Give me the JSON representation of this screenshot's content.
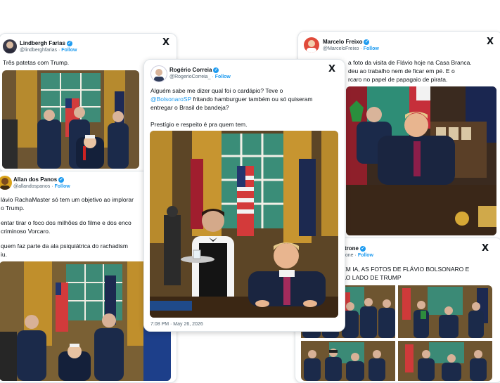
{
  "cards": {
    "lindbergh": {
      "name": "Lindbergh Farias",
      "handle": "@lindberghfarias",
      "follow": "Follow",
      "text": "Três patetas com Trump."
    },
    "allan": {
      "name": "Allan dos Panos",
      "handle": "@allandospanos",
      "follow": "Follow",
      "lines": [
        "lávio RachaMaster só tem um objetivo ao implorar",
        "o Trump.",
        "",
        "entar tirar o foco dos milhões do filme e dos enco",
        "criminoso Vorcaro.",
        "",
        "quem faz parte da ala psiquiátrica do rachadism",
        "iu."
      ]
    },
    "rogerio": {
      "name": "Rogério Correia",
      "handle": "@RogerioCorreia_",
      "follow": "Follow",
      "line1": "Alguém sabe me dizer qual foi o cardápio? Teve o",
      "mention": "@BolsonaroSP",
      "line2_rest": " fritando hamburguer também ou só quiseram",
      "line3": "entregar o Brasil de bandeja?",
      "line4": "Prestígio e respeito é pra quem tem.",
      "timestamp": "7:08 PM · May 26, 2026"
    },
    "marcelo": {
      "name": "Marcelo Freixo",
      "handle": "@MarceloFreixo",
      "follow": "Follow",
      "lines": [
        "a foto da visita de Flávio hoje na Casa Branca.",
        "deu ao trabalho nem de ficar em pé. E o",
        "rcaro no papel de papagaio de pirata."
      ]
    },
    "taliria": {
      "name": "Talíria Petrone",
      "handle": "@taliriapetrone",
      "follow": "Follow",
      "lines": [
        "AGORA SIM, SEM IA, AS FOTOS DE FLÁVIO BOLSONARO E",
        "SUA GANGUE AO LADO DE TRUMP"
      ]
    }
  },
  "icons": {
    "close": "X",
    "verified": "✓"
  },
  "colors": {
    "link": "#1d9bf0",
    "gold": "#c9a23a",
    "window_green": "#2f8f7a",
    "suit": "#1b2a4a"
  }
}
